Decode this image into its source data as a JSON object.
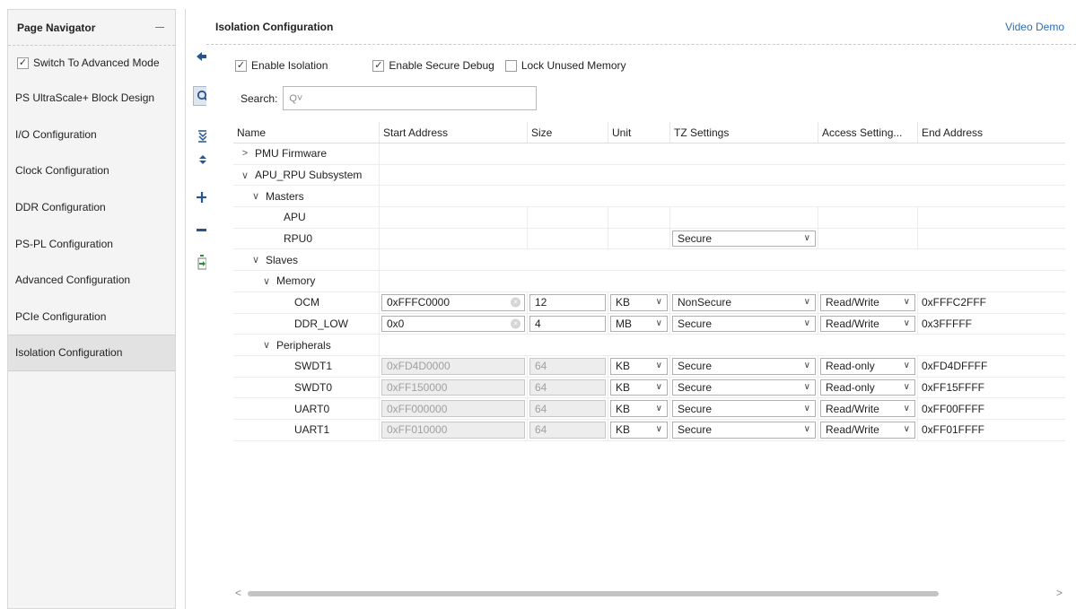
{
  "navigator": {
    "title": "Page Navigator",
    "advanced_mode": {
      "label": "Switch To Advanced Mode",
      "checked": true
    },
    "items": [
      {
        "label": "PS UltraScale+ Block Design"
      },
      {
        "label": "I/O Configuration"
      },
      {
        "label": "Clock Configuration"
      },
      {
        "label": "DDR Configuration"
      },
      {
        "label": "PS-PL Configuration"
      },
      {
        "label": "Advanced Configuration"
      },
      {
        "label": "PCIe Configuration"
      },
      {
        "label": "Isolation Configuration",
        "active": true
      }
    ]
  },
  "toolbar": {
    "icons": [
      "back-arrow-icon",
      "search-icon",
      "collapse-all-icon",
      "expand-all-icon",
      "add-icon",
      "remove-icon",
      "import-icon"
    ]
  },
  "main": {
    "title": "Isolation Configuration",
    "video_demo": "Video Demo",
    "options": [
      {
        "label": "Enable Isolation",
        "checked": true
      },
      {
        "label": "Enable Secure Debug",
        "checked": true
      },
      {
        "label": "Lock Unused Memory",
        "checked": false
      }
    ],
    "search": {
      "label": "Search:",
      "placeholder": "Q˅"
    }
  },
  "table": {
    "headers": [
      "Name",
      "Start Address",
      "Size",
      "Unit",
      "TZ Settings",
      "Access Setting...",
      "End Address"
    ],
    "rows": [
      {
        "indent": 0,
        "arrow": ">",
        "name": "PMU Firmware",
        "kind": "group"
      },
      {
        "indent": 0,
        "arrow": "∨",
        "name": "APU_RPU Subsystem",
        "kind": "group"
      },
      {
        "indent": 1,
        "arrow": "∨",
        "name": "Masters",
        "kind": "group"
      },
      {
        "indent": 3,
        "arrow": "",
        "name": "APU",
        "kind": "master"
      },
      {
        "indent": 3,
        "arrow": "",
        "name": "RPU0",
        "kind": "master",
        "tz": "Secure"
      },
      {
        "indent": 1,
        "arrow": "∨",
        "name": "Slaves",
        "kind": "group"
      },
      {
        "indent": 2,
        "arrow": "∨",
        "name": "Memory",
        "kind": "group"
      },
      {
        "indent": 4,
        "arrow": "",
        "name": "OCM",
        "kind": "slave",
        "start": "0xFFFC0000",
        "size": "12",
        "unit": "KB",
        "tz": "NonSecure",
        "access": "Read/Write",
        "end": "0xFFFC2FFF",
        "editable": true
      },
      {
        "indent": 4,
        "arrow": "",
        "name": "DDR_LOW",
        "kind": "slave",
        "start": "0x0",
        "size": "4",
        "unit": "MB",
        "tz": "Secure",
        "access": "Read/Write",
        "end": "0x3FFFFF",
        "editable": true
      },
      {
        "indent": 2,
        "arrow": "∨",
        "name": "Peripherals",
        "kind": "group"
      },
      {
        "indent": 4,
        "arrow": "",
        "name": "SWDT1",
        "kind": "slave",
        "start": "0xFD4D0000",
        "size": "64",
        "unit": "KB",
        "tz": "Secure",
        "access": "Read-only",
        "end": "0xFD4DFFFF",
        "editable": false
      },
      {
        "indent": 4,
        "arrow": "",
        "name": "SWDT0",
        "kind": "slave",
        "start": "0xFF150000",
        "size": "64",
        "unit": "KB",
        "tz": "Secure",
        "access": "Read-only",
        "end": "0xFF15FFFF",
        "editable": false
      },
      {
        "indent": 4,
        "arrow": "",
        "name": "UART0",
        "kind": "slave",
        "start": "0xFF000000",
        "size": "64",
        "unit": "KB",
        "tz": "Secure",
        "access": "Read/Write",
        "end": "0xFF00FFFF",
        "editable": false
      },
      {
        "indent": 4,
        "arrow": "",
        "name": "UART1",
        "kind": "slave",
        "start": "0xFF010000",
        "size": "64",
        "unit": "KB",
        "tz": "Secure",
        "access": "Read/Write",
        "end": "0xFF01FFFF",
        "editable": false
      }
    ]
  },
  "scrollbar": {
    "left": "<",
    "right": ">"
  }
}
